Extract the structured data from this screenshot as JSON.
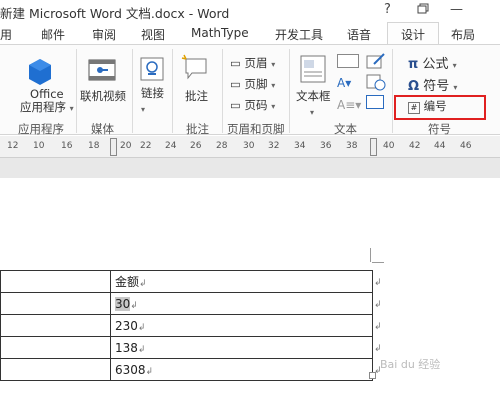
{
  "window": {
    "title": "新建 Microsoft Word 文档.docx - Word",
    "help": "?",
    "restore_icon": "restore-icon",
    "minimize": "—"
  },
  "tabs": [
    {
      "label": "用"
    },
    {
      "label": "邮件"
    },
    {
      "label": "审阅"
    },
    {
      "label": "视图"
    },
    {
      "label": "MathType"
    },
    {
      "label": "开发工具"
    },
    {
      "label": "语音"
    },
    {
      "label": "设计"
    },
    {
      "label": "布局"
    }
  ],
  "ribbon": {
    "groups": {
      "apps": "应用程序",
      "media": "媒体",
      "comments": "批注",
      "header_footer": "页眉和页脚",
      "text": "文本",
      "symbols": "符号"
    },
    "office_app": "Office\n应用程序",
    "online_video": "联机视频",
    "link": "链接",
    "comment": "批注",
    "header": "页眉",
    "footer": "页脚",
    "page_number": "页码",
    "textbox": "文本框",
    "equation": "公式",
    "symbol": "符号",
    "numbering": "编号"
  },
  "ruler": {
    "ticks": [
      "12",
      "10",
      "8",
      "16",
      "18",
      "20",
      "22",
      "24",
      "26",
      "28",
      "30",
      "32",
      "34",
      "36",
      "38",
      "40",
      "42",
      "44",
      "46"
    ]
  },
  "table": {
    "header": "金额",
    "rows": [
      "30",
      "230",
      "138",
      "6308"
    ],
    "cell_mark": "↲"
  },
  "watermark": "Bai du 经验"
}
